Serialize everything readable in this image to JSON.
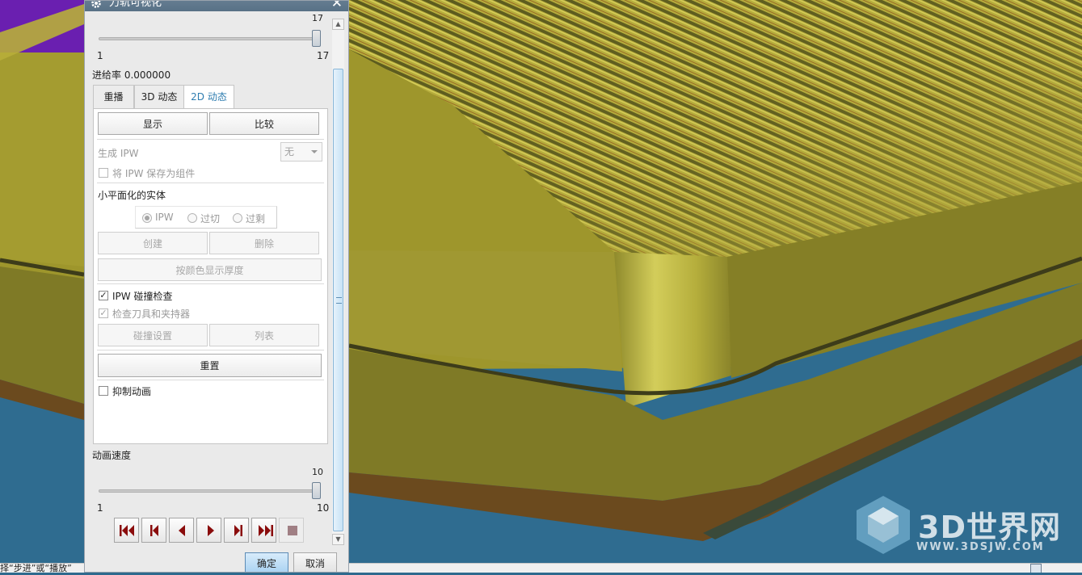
{
  "dialog": {
    "title": "刀轨可视化",
    "step_slider": {
      "current_label": "17",
      "min_label": "1",
      "max_label": "17",
      "value": 17,
      "min": 1,
      "max": 17
    },
    "feed_rate": "进给率 0.000000",
    "tabs": [
      {
        "label": "重播",
        "active": false
      },
      {
        "label": "3D 动态",
        "active": false
      },
      {
        "label": "2D 动态",
        "active": true
      }
    ],
    "panel": {
      "display_button": "显示",
      "compare_button": "比较",
      "generate_ipw_label": "生成 IPW",
      "generate_ipw_value": "无",
      "save_ipw_component": {
        "label": "将 IPW 保存为组件",
        "checked": false
      },
      "faceted_solid_label": "小平面化的实体",
      "radio_options": [
        {
          "label": "IPW",
          "selected": true
        },
        {
          "label": "过切",
          "selected": false
        },
        {
          "label": "过剩",
          "selected": false
        }
      ],
      "create_button": "创建",
      "delete_button": "删除",
      "thickness_color_button": "按颜色显示厚度",
      "ipw_collision_check": {
        "label": "IPW 碰撞检查",
        "checked": true
      },
      "check_tool_holder": {
        "label": "检查刀具和夹持器",
        "checked": true
      },
      "collision_settings_button": "碰撞设置",
      "list_button": "列表",
      "reset_button": "重置",
      "suppress_animation": {
        "label": "抑制动画",
        "checked": false
      }
    },
    "animation_speed": {
      "label": "动画速度",
      "current_label": "10",
      "min_label": "1",
      "max_label": "10",
      "value": 10,
      "min": 1,
      "max": 10
    },
    "playback_icons": [
      "rewind-to-start-icon",
      "step-back-icon",
      "play-reverse-icon",
      "play-forward-icon",
      "step-forward-icon",
      "fast-forward-icon",
      "stop-icon"
    ],
    "ok_button": "确定",
    "cancel_button": "取消"
  },
  "status_bar": {
    "message": "择“步进”或“播放”"
  },
  "watermark": {
    "text": "3D世界网",
    "url": "WWW.3DSJW.COM"
  },
  "colors": {
    "part_yellow": "#a39b2e",
    "part_dark": "#4b4b26",
    "fixture_blue": "#2e6a8e",
    "purple": "#6a1fb0",
    "brown": "#6b4a1e",
    "dialog_bg": "#eaeaea",
    "title_bar": "#5f778c"
  }
}
